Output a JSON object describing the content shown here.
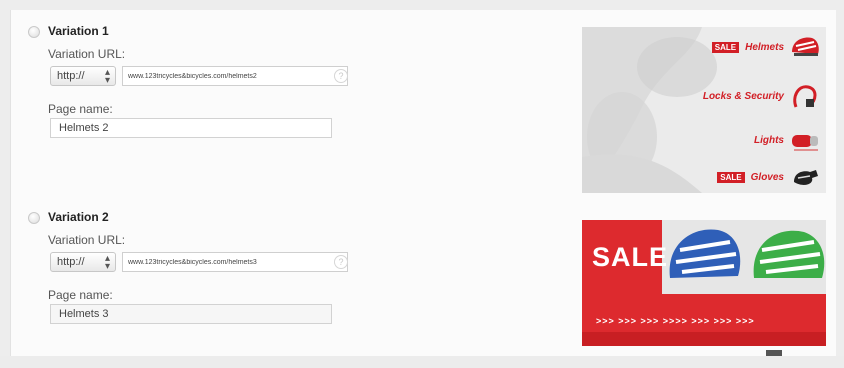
{
  "variations": [
    {
      "title": "Variation 1",
      "url_label": "Variation URL:",
      "protocol": "http://",
      "url": "www.123tricycles&bicycles.com/helmets2",
      "page_label": "Page name:",
      "page_name": "Helmets 2"
    },
    {
      "title": "Variation 2",
      "url_label": "Variation URL:",
      "protocol": "http://",
      "url": "www.123tricycles&bicycles.com/helmets3",
      "page_label": "Page name:",
      "page_name": "Helmets 3"
    }
  ],
  "help_glyph": "?",
  "banner1": {
    "rows": [
      {
        "badge": "SALE",
        "label": "Helmets"
      },
      {
        "badge": "",
        "label": "Locks & Security"
      },
      {
        "badge": "",
        "label": "Lights"
      },
      {
        "badge": "SALE",
        "label": "Gloves"
      }
    ]
  },
  "banner2": {
    "sale_text": "SALE",
    "arrows_text": ">>> >>> >>> >>>> >>> >>> >>>"
  },
  "colors": {
    "accent_red": "#d21f26",
    "helmet_blue": "#2f5fb8",
    "helmet_green": "#3cae48"
  }
}
